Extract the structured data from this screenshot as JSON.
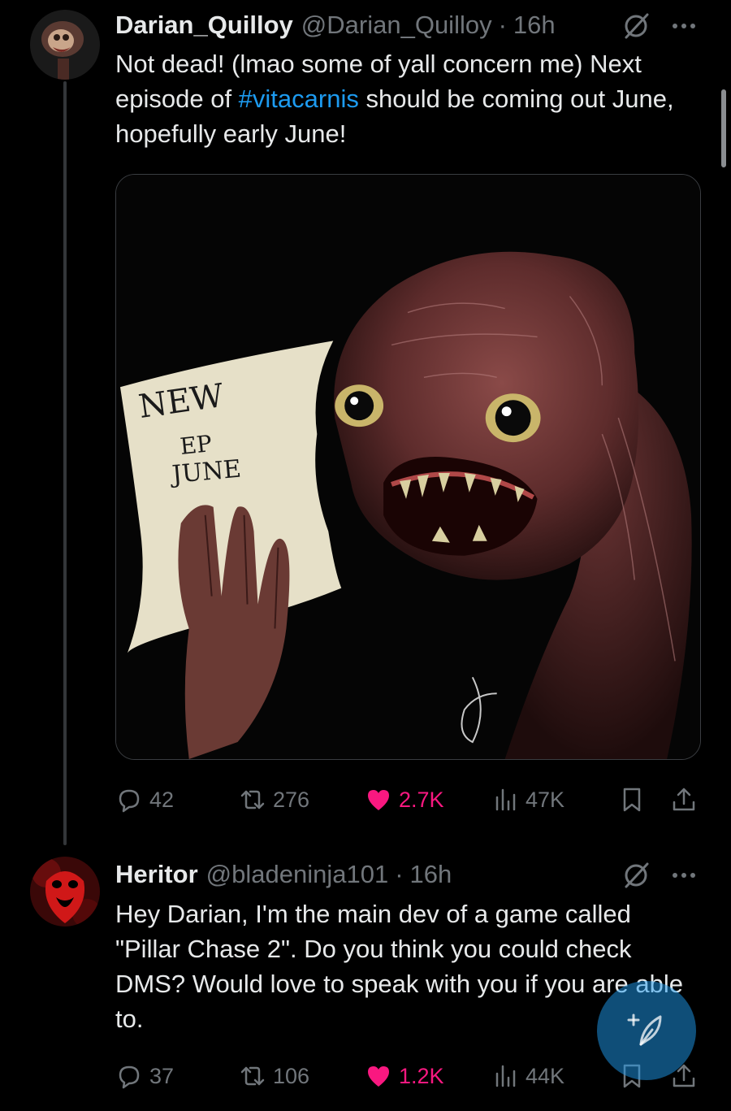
{
  "tweets": [
    {
      "author_name": "Darian_Quilloy",
      "handle": "@Darian_Quilloy",
      "separator": "·",
      "time": "16h",
      "text_before": "Not dead! (lmao some of yall concern me) Next episode of ",
      "hashtag": "#vitacarnis",
      "text_after": " should be coming out June, hopefully early June!",
      "media": {
        "note_line1": "NEW",
        "note_line2": "EP",
        "note_line3": "JUNE"
      },
      "stats": {
        "replies": "42",
        "reposts": "276",
        "likes": "2.7K",
        "views": "47K"
      }
    },
    {
      "author_name": "Heritor",
      "handle": "@bladeninja101",
      "separator": "·",
      "time": "16h",
      "text": "Hey Darian, I'm the main dev of a game called \"Pillar Chase 2\". Do you think you could check DMS? Would love to speak with you if you are able to.",
      "stats": {
        "replies": "37",
        "reposts": "106",
        "likes": "1.2K",
        "views": "44K"
      }
    }
  ],
  "colors": {
    "background": "#000000",
    "text": "#e7e9ea",
    "muted": "#71767b",
    "link": "#1d9bf0",
    "like": "#f91880",
    "fab": "#1d9bf0"
  },
  "icons": [
    "reply-icon",
    "repost-icon",
    "heart-icon",
    "views-icon",
    "bookmark-icon",
    "share-icon",
    "grok-icon",
    "more-icon",
    "compose-icon"
  ]
}
